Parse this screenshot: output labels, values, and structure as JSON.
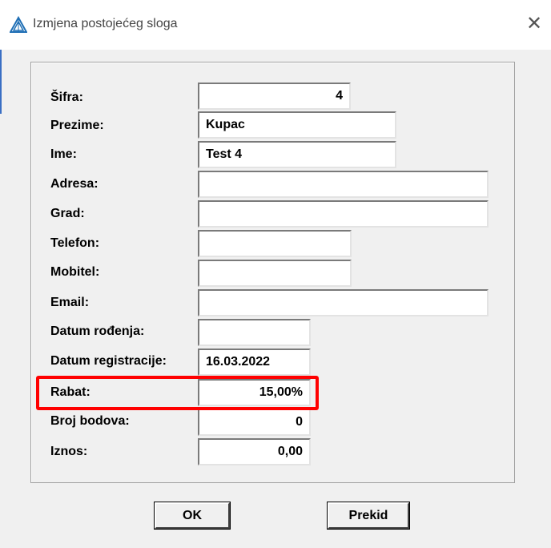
{
  "window": {
    "title": "Izmjena postojećeg sloga"
  },
  "form": {
    "sifra": {
      "label": "Šifra:",
      "value": "4"
    },
    "prezime": {
      "label": "Prezime:",
      "value": "Kupac"
    },
    "ime": {
      "label": "Ime:",
      "value": "Test 4"
    },
    "adresa": {
      "label": "Adresa:",
      "value": ""
    },
    "grad": {
      "label": "Grad:",
      "value": ""
    },
    "telefon": {
      "label": "Telefon:",
      "value": ""
    },
    "mobitel": {
      "label": "Mobitel:",
      "value": ""
    },
    "email": {
      "label": "Email:",
      "value": ""
    },
    "datum_rodjenja": {
      "label": "Datum rođenja:",
      "value": ""
    },
    "datum_registracije": {
      "label": "Datum registracije:",
      "value": "16.03.2022"
    },
    "rabat": {
      "label": "Rabat:",
      "value": "15,00%"
    },
    "broj_bodova": {
      "label": "Broj bodova:",
      "value": "0"
    },
    "iznos": {
      "label": "Iznos:",
      "value": "0,00"
    }
  },
  "buttons": {
    "ok": "OK",
    "cancel": "Prekid"
  },
  "icons": {
    "app": "app-logo-icon",
    "close": "close-icon"
  },
  "colors": {
    "highlight": "#ff0000"
  }
}
